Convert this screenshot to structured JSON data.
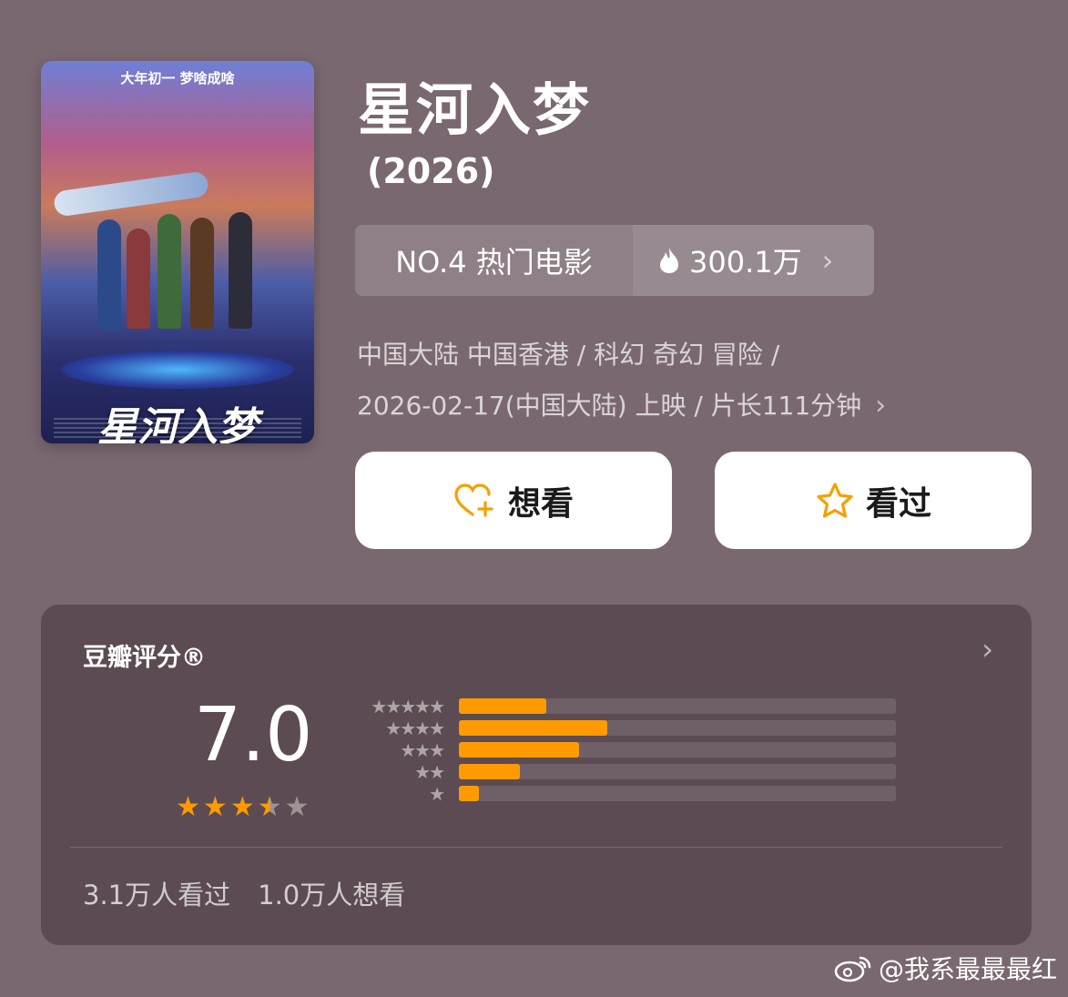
{
  "poster": {
    "tagline": "大年初一 梦啥成啥",
    "title": "星河入梦"
  },
  "movie": {
    "title": "星河入梦",
    "year": "(2026)"
  },
  "ranking": {
    "label": "NO.4 热门电影",
    "heat": "300.1万"
  },
  "meta": {
    "line1": "中国大陆 中国香港 / 科幻 奇幻 冒险 /",
    "line2": "2026-02-17(中国大陆) 上映 / 片长111分钟"
  },
  "buttons": {
    "want": "想看",
    "seen": "看过"
  },
  "rating": {
    "label": "豆瓣评分®",
    "score": "7.0",
    "stars": 3.5,
    "distribution": [
      {
        "stars": 5,
        "fraction": 0.2
      },
      {
        "stars": 4,
        "fraction": 0.34
      },
      {
        "stars": 3,
        "fraction": 0.275
      },
      {
        "stars": 2,
        "fraction": 0.14
      },
      {
        "stars": 1,
        "fraction": 0.045
      }
    ],
    "seen_count": "3.1万人看过",
    "want_count": "1.0万人想看"
  },
  "watermark": "@我系最最最红",
  "colors": {
    "background": "#7a6870",
    "card": "#5c4b52",
    "accent": "#ff9b00"
  }
}
